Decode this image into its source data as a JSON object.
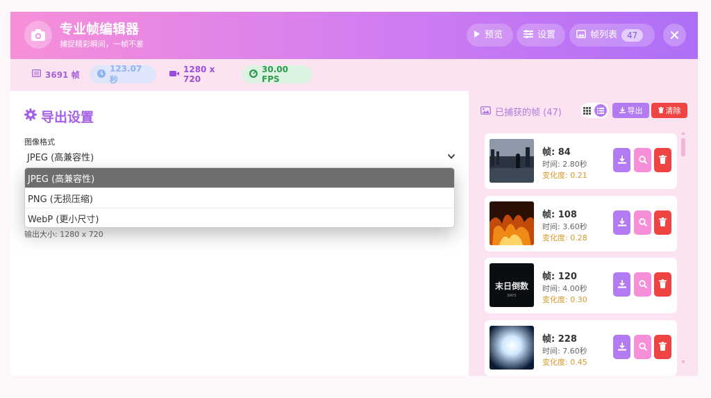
{
  "header": {
    "title": "专业帧编辑器",
    "subtitle": "捕捉精彩瞬间，一帧不差",
    "preview_label": "预览",
    "settings_label": "设置",
    "framelist_label": "帧列表",
    "framelist_count": "47"
  },
  "stats": {
    "frames": "3691 帧",
    "duration": "123.07 秒",
    "resolution": "1280 x 720",
    "fps": "30.00 FPS"
  },
  "export": {
    "title": "导出设置",
    "format_label": "图像格式",
    "format_value": "JPEG (高兼容性)",
    "options": [
      "JPEG (高兼容性)",
      "PNG (无损压缩)",
      "WebP (更小尺寸)"
    ],
    "output_size": "输出大小: 1280 x 720"
  },
  "captured": {
    "title": "已捕获的帧 (47)",
    "export_label": "导出",
    "clear_label": "清除",
    "frames": [
      {
        "frame": "帧: 84",
        "time": "时间: 2.80秒",
        "change": "变化度: 0.21"
      },
      {
        "frame": "帧: 108",
        "time": "时间: 3.60秒",
        "change": "变化度: 0.28"
      },
      {
        "frame": "帧: 120",
        "time": "时间: 4.00秒",
        "change": "变化度: 0.30"
      },
      {
        "frame": "帧: 228",
        "time": "时间: 7.60秒",
        "change": "变化度: 0.45"
      }
    ]
  },
  "thumb_text": {
    "line1": "末日倒数",
    "line2": "DAYS"
  },
  "colors": {
    "accent": "#b37bf2",
    "header_start": "#f78fd8",
    "header_end": "#ae6ff7",
    "danger": "#ef4444",
    "magnify": "#f78fd8",
    "change_text": "#d69a2a"
  },
  "icons": {
    "logo": "camera-icon",
    "preview": "play-icon",
    "settings": "sliders-icon",
    "framelist": "image-icon",
    "close": "close-icon",
    "frames": "film-icon",
    "duration": "clock-icon",
    "resolution": "video-icon",
    "fps": "gauge-icon",
    "export_title": "gear-icon",
    "captured": "images-icon"
  }
}
